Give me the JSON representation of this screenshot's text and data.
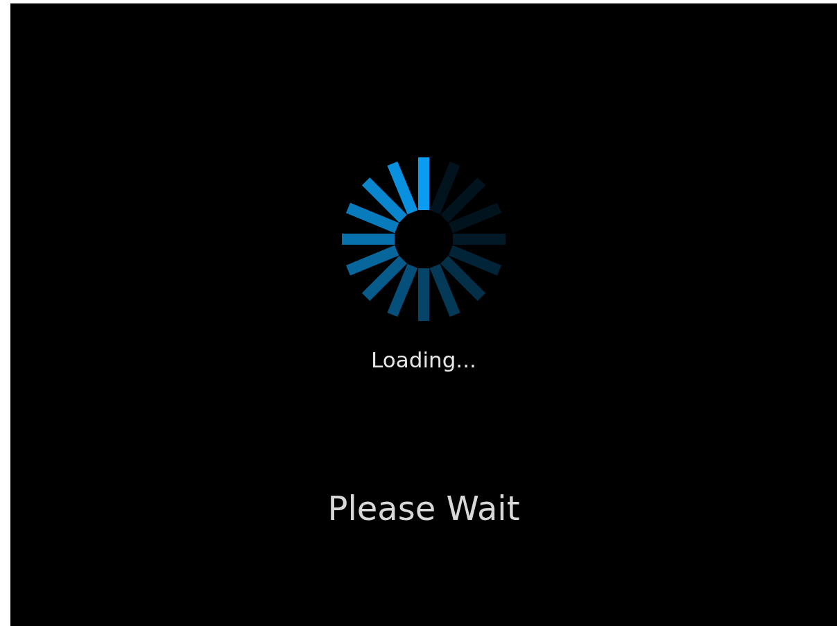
{
  "status": "Loading...",
  "message": "Please Wait"
}
